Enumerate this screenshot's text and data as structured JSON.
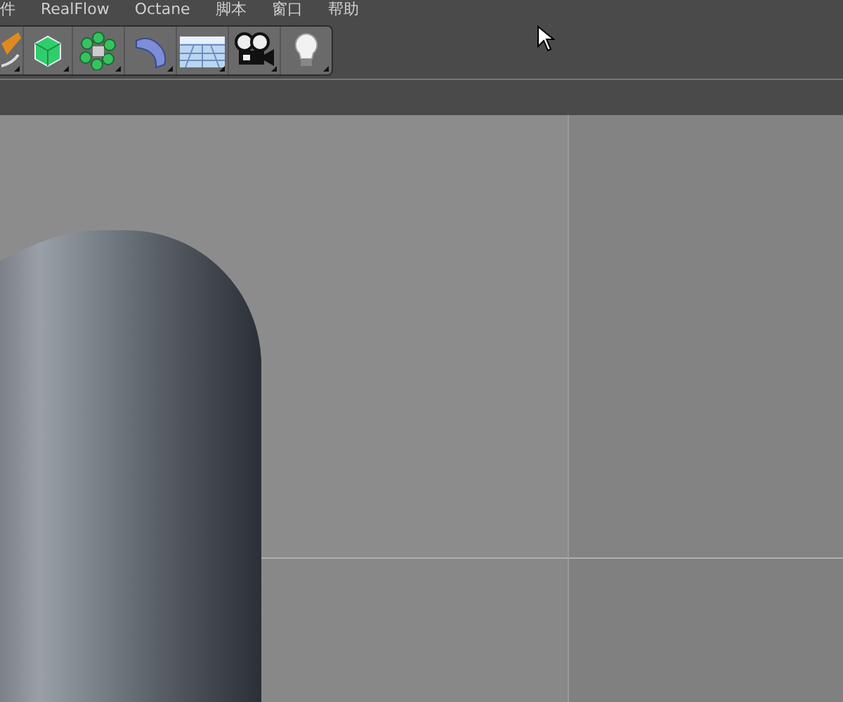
{
  "menu_bar": {
    "items": [
      {
        "label": "件"
      },
      {
        "label": "RealFlow"
      },
      {
        "label": "Octane"
      },
      {
        "label": "脚本"
      },
      {
        "label": "窗口"
      },
      {
        "label": "帮助"
      }
    ]
  }
}
